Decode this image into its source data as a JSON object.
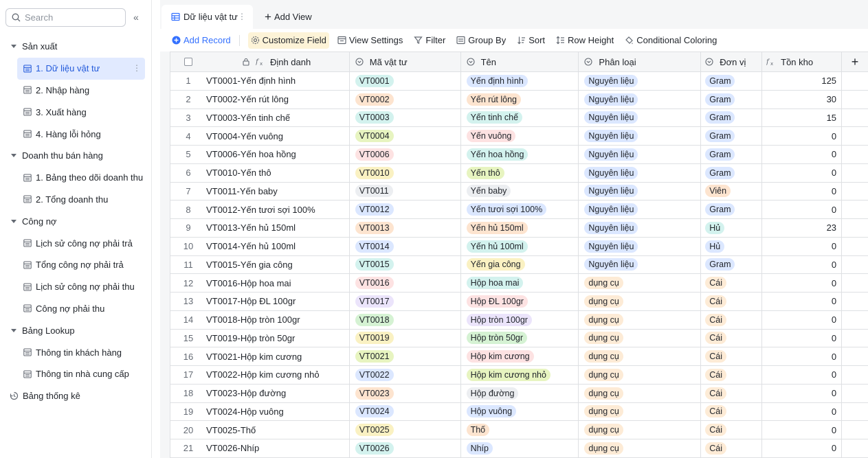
{
  "sidebar": {
    "search_placeholder": "Search",
    "collapse_glyph": "«",
    "groups": [
      {
        "label": "Sản xuất",
        "items": [
          "1. Dữ liệu vật tư",
          "2. Nhập hàng",
          "3. Xuất hàng",
          "4. Hàng lỗi hỏng"
        ]
      },
      {
        "label": "Doanh thu bán hàng",
        "items": [
          "1. Bảng theo dõi doanh thu",
          "2. Tổng doanh thu"
        ]
      },
      {
        "label": "Công nợ",
        "items": [
          "Lịch sử công nợ phải trả",
          "Tổng công nợ phải trả",
          "Lịch sử công nợ phải thu",
          "Công nợ phải thu"
        ]
      },
      {
        "label": "Bảng Lookup",
        "items": [
          "Thông tin khách hàng",
          "Thông tin nhà cung cấp"
        ]
      }
    ],
    "root_item": "Bảng thống kê",
    "active_item": "1. Dữ liệu vật tư",
    "more_glyph": "⋮"
  },
  "tabs": {
    "active_label": "Dữ liệu vật tư",
    "add_view_label": "Add View",
    "dots": "⋮"
  },
  "toolbar": {
    "add_record": "Add Record",
    "customize_field": "Customize Field",
    "view_settings": "View Settings",
    "filter": "Filter",
    "group_by": "Group By",
    "sort": "Sort",
    "row_height": "Row Height",
    "conditional_coloring": "Conditional Coloring"
  },
  "table": {
    "headers": {
      "dinh_danh": "Định danh",
      "ma_vat_tu": "Mã vật tư",
      "ten": "Tên",
      "phan_loai": "Phân loại",
      "don_vi": "Đơn vị",
      "ton_kho": "Tồn kho",
      "add_column": "+"
    },
    "tag_colors": {
      "blue": "#dbe7ff",
      "orange": "#fde4cf",
      "teal": "#d3f2ee",
      "lime": "#e7f4c0",
      "red": "#fde2e2",
      "yellow": "#faf1c2",
      "grey": "#eceef1",
      "purple": "#ebe4fb",
      "green": "#d5f2d3",
      "peach": "#fdebd6"
    },
    "rows": [
      {
        "no": "1",
        "id": "VT0001-Yến định hình",
        "code": "VT0001",
        "code_color": "teal",
        "name": "Yến định hình",
        "name_color": "blue",
        "category": "Nguyên liệu",
        "unit": "Gram",
        "unit_color": "blue",
        "stock": "125"
      },
      {
        "no": "2",
        "id": "VT0002-Yến rút lông",
        "code": "VT0002",
        "code_color": "orange",
        "name": "Yến rút lông",
        "name_color": "orange",
        "category": "Nguyên liệu",
        "unit": "Gram",
        "unit_color": "blue",
        "stock": "30"
      },
      {
        "no": "3",
        "id": "VT0003-Yến tinh chế",
        "code": "VT0003",
        "code_color": "teal",
        "name": "Yến tinh chế",
        "name_color": "teal",
        "category": "Nguyên liệu",
        "unit": "Gram",
        "unit_color": "blue",
        "stock": "15"
      },
      {
        "no": "4",
        "id": "VT0004-Yến vuông",
        "code": "VT0004",
        "code_color": "lime",
        "name": "Yến vuông",
        "name_color": "red",
        "category": "Nguyên liệu",
        "unit": "Gram",
        "unit_color": "blue",
        "stock": "0"
      },
      {
        "no": "5",
        "id": "VT0006-Yến hoa hồng",
        "code": "VT0006",
        "code_color": "red",
        "name": "Yến hoa hồng",
        "name_color": "teal",
        "category": "Nguyên liệu",
        "unit": "Gram",
        "unit_color": "blue",
        "stock": "0"
      },
      {
        "no": "6",
        "id": "VT0010-Yến thô",
        "code": "VT0010",
        "code_color": "yellow",
        "name": "Yến thô",
        "name_color": "lime",
        "category": "Nguyên liệu",
        "unit": "Gram",
        "unit_color": "blue",
        "stock": "0"
      },
      {
        "no": "7",
        "id": "VT0011-Yến baby",
        "code": "VT0011",
        "code_color": "grey",
        "name": "Yến baby",
        "name_color": "grey",
        "category": "Nguyên liệu",
        "unit": "Viên",
        "unit_color": "orange",
        "stock": "0"
      },
      {
        "no": "8",
        "id": "VT0012-Yến tươi sợi 100%",
        "code": "VT0012",
        "code_color": "blue",
        "name": "Yến tươi sợi 100%",
        "name_color": "blue",
        "category": "Nguyên liệu",
        "unit": "Gram",
        "unit_color": "blue",
        "stock": "0"
      },
      {
        "no": "9",
        "id": "VT0013-Yến hủ 150ml",
        "code": "VT0013",
        "code_color": "orange",
        "name": "Yến hủ 150ml",
        "name_color": "orange",
        "category": "Nguyên liệu",
        "unit": "Hủ",
        "unit_color": "teal",
        "stock": "23"
      },
      {
        "no": "10",
        "id": "VT0014-Yến hủ 100ml",
        "code": "VT0014",
        "code_color": "blue",
        "name": "Yến hủ 100ml",
        "name_color": "teal",
        "category": "Nguyên liệu",
        "unit": "Hủ",
        "unit_color": "blue",
        "stock": "0"
      },
      {
        "no": "11",
        "id": "VT0015-Yến gia công",
        "code": "VT0015",
        "code_color": "teal",
        "name": "Yến gia công",
        "name_color": "yellow",
        "category": "Nguyên liệu",
        "unit": "Gram",
        "unit_color": "blue",
        "stock": "0"
      },
      {
        "no": "12",
        "id": "VT0016-Hộp hoa mai",
        "code": "VT0016",
        "code_color": "red",
        "name": "Hộp hoa mai",
        "name_color": "teal",
        "category": "dụng cụ",
        "unit": "Cái",
        "unit_color": "peach",
        "stock": "0"
      },
      {
        "no": "13",
        "id": "VT0017-Hộp ĐL 100gr",
        "code": "VT0017",
        "code_color": "purple",
        "name": "Hộp ĐL 100gr",
        "name_color": "red",
        "category": "dụng cụ",
        "unit": "Cái",
        "unit_color": "peach",
        "stock": "0"
      },
      {
        "no": "14",
        "id": "VT0018-Hộp tròn 100gr",
        "code": "VT0018",
        "code_color": "green",
        "name": "Hộp tròn 100gr",
        "name_color": "purple",
        "category": "dụng cụ",
        "unit": "Cái",
        "unit_color": "peach",
        "stock": "0"
      },
      {
        "no": "15",
        "id": "VT0019-Hộp tròn 50gr",
        "code": "VT0019",
        "code_color": "yellow",
        "name": "Hộp tròn 50gr",
        "name_color": "green",
        "category": "dụng cụ",
        "unit": "Cái",
        "unit_color": "peach",
        "stock": "0"
      },
      {
        "no": "16",
        "id": "VT0021-Hộp kim cương",
        "code": "VT0021",
        "code_color": "lime",
        "name": "Hộp kim cương",
        "name_color": "red",
        "category": "dụng cụ",
        "unit": "Cái",
        "unit_color": "peach",
        "stock": "0"
      },
      {
        "no": "17",
        "id": "VT0022-Hộp kim cương nhỏ",
        "code": "VT0022",
        "code_color": "blue",
        "name": "Hộp kim cương nhỏ",
        "name_color": "lime",
        "category": "dụng cụ",
        "unit": "Cái",
        "unit_color": "peach",
        "stock": "0"
      },
      {
        "no": "18",
        "id": "VT0023-Hộp đường",
        "code": "VT0023",
        "code_color": "orange",
        "name": "Hộp đường",
        "name_color": "grey",
        "category": "dụng cụ",
        "unit": "Cái",
        "unit_color": "peach",
        "stock": "0"
      },
      {
        "no": "19",
        "id": "VT0024-Hộp vuông",
        "code": "VT0024",
        "code_color": "blue",
        "name": "Hộp vuông",
        "name_color": "blue",
        "category": "dụng cụ",
        "unit": "Cái",
        "unit_color": "peach",
        "stock": "0"
      },
      {
        "no": "20",
        "id": "VT0025-Thố",
        "code": "VT0025",
        "code_color": "yellow",
        "name": "Thố",
        "name_color": "orange",
        "category": "dụng cụ",
        "unit": "Cái",
        "unit_color": "peach",
        "stock": "0"
      },
      {
        "no": "21",
        "id": "VT0026-Nhíp",
        "code": "VT0026",
        "code_color": "teal",
        "name": "Nhíp",
        "name_color": "blue",
        "category": "dụng cụ",
        "unit": "Cái",
        "unit_color": "peach",
        "stock": "0"
      }
    ],
    "category_colors": {
      "Nguyên liệu": "blue",
      "dụng cụ": "peach"
    }
  }
}
